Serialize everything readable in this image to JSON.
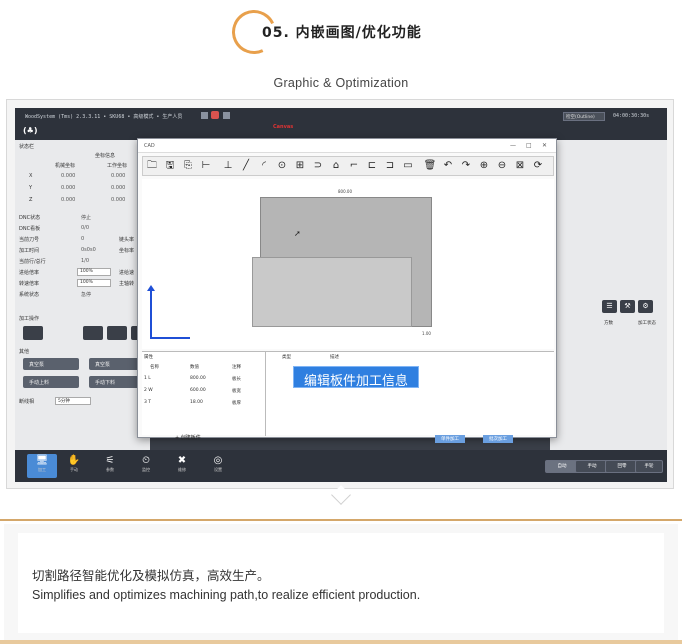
{
  "header": {
    "title": "05. 内嵌画图/优化功能",
    "subtitle": "Graphic & Optimization"
  },
  "colors": {
    "accent": "#e8a04c",
    "highlight_blue": "#2f7fe0",
    "dark_bar": "#2d323b"
  },
  "app": {
    "title_bar": "WoodSystem (Tms) 2.3.3.11 • SKU68 • 高级模式 • 生产人员",
    "warning": "Canvas",
    "search_value": "检空(Outline)",
    "clock": "04:00:30:30s",
    "logo": "(♣)"
  },
  "left_panel": {
    "status_section": "状态栏",
    "coord_header": "坐标信息",
    "mach_coord": "机械坐标",
    "work_coord": "工作坐标",
    "axes": [
      {
        "axis": "X",
        "mach": "0.000",
        "work": "0.000"
      },
      {
        "axis": "Y",
        "mach": "0.000",
        "work": "0.000"
      },
      {
        "axis": "Z",
        "mach": "0.000",
        "work": "0.000"
      }
    ],
    "status_rows": [
      {
        "label": "DNC状态",
        "value": "停止"
      },
      {
        "label": "DNC看板",
        "value": "0/0"
      },
      {
        "label": "当前刀号",
        "value": "0"
      },
      {
        "label": "加工时间",
        "value": "0s0s0"
      },
      {
        "label": "当前行/总行",
        "value": "1/0"
      },
      {
        "label": "进给倍率",
        "value": "100%"
      },
      {
        "label": "转速倍率",
        "value": "100%"
      },
      {
        "label": "系统状态",
        "value": "急停"
      }
    ],
    "side_labels": [
      "链头率",
      "坐标率",
      "进给速",
      "主轴转"
    ],
    "process_section": "加工操作",
    "other_section": "其他",
    "vacuum_on": "真空泵",
    "vacuum_off": "真空泵",
    "manual_up": "手动上料",
    "manual_down": "手动下料",
    "spacing_label": "断线相",
    "spacing_value": "5分钟"
  },
  "cad": {
    "title": "CAD",
    "dim_top": "800.00",
    "dim_right": "1.00",
    "tools": [
      "open-icon",
      "save-icon",
      "export-icon",
      "dimension-icon",
      "point-icon",
      "line-icon",
      "arc-icon",
      "circle-icon",
      "rect-icon",
      "slot-icon",
      "offset-icon",
      "corner-icon",
      "trim-icon",
      "extend-icon",
      "align-icon",
      "delete-icon",
      "undo-icon",
      "redo-icon",
      "zoom-in-icon",
      "zoom-out-icon",
      "fit-icon",
      "refresh-icon"
    ],
    "tools_glyph": [
      "🗀",
      "🖫",
      "⎘",
      "⊢",
      "⊥",
      "╱",
      "◜",
      "⊙",
      "⊞",
      "⊃",
      "⌂",
      "⌐",
      "⊏",
      "⊐",
      "▭",
      "🗑",
      "↶",
      "↷",
      "⊕",
      "⊖",
      "⊠",
      "⟳"
    ],
    "left_table_title": "属性",
    "left_headers": [
      "名称",
      "数值",
      "注释"
    ],
    "left_rows": [
      {
        "name": "1 L",
        "value": "800.00",
        "note": "板长"
      },
      {
        "name": "2 W",
        "value": "600.00",
        "note": "板宽"
      },
      {
        "name": "3 T",
        "value": "18.00",
        "note": "板厚"
      }
    ],
    "right_headers": [
      "类型",
      "描述"
    ],
    "add_button": "+ 创建板件",
    "highlight_label": "编辑板件加工信息"
  },
  "right_panel": {
    "col_a": "方数",
    "col_b": "加工状态",
    "btn_a": "单件加工",
    "btn_b": "批次加工"
  },
  "bottom_nav": [
    {
      "label": "加工",
      "icon": "monitor-icon",
      "glyph": "🖥"
    },
    {
      "label": "手动",
      "icon": "hand-icon",
      "glyph": "✋"
    },
    {
      "label": "参数",
      "icon": "sliders-icon",
      "glyph": "⚟"
    },
    {
      "label": "监控",
      "icon": "gauge-icon",
      "glyph": "⏲"
    },
    {
      "label": "维修",
      "icon": "tools-icon",
      "glyph": "✖"
    },
    {
      "label": "设置",
      "icon": "settings-icon",
      "glyph": "◎"
    }
  ],
  "bottom_modes": [
    {
      "label": "自动"
    },
    {
      "label": "手动"
    },
    {
      "label": "回零"
    },
    {
      "label": "手轮"
    }
  ],
  "footer": {
    "cn": "切割路径智能优化及模拟仿真，高效生产。",
    "en": "Simplifies and optimizes machining path,to realize efficient production."
  }
}
